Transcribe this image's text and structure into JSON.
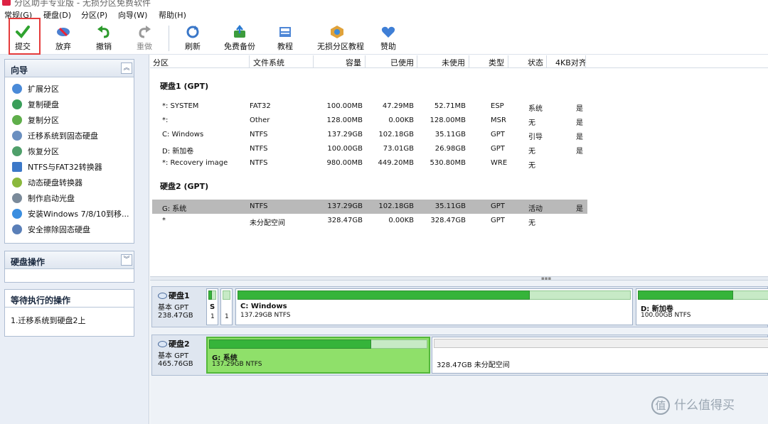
{
  "titlebar": {
    "text": "分区助手专业版 - 无损分区免费软件"
  },
  "menu": [
    {
      "label": "常规(G)"
    },
    {
      "label": "硬盘(D)"
    },
    {
      "label": "分区(P)"
    },
    {
      "label": "向导(W)"
    },
    {
      "label": "帮助(H)"
    }
  ],
  "toolbar": [
    {
      "label": "提交",
      "icon": "check-icon",
      "enabled": true
    },
    {
      "label": "放弃",
      "icon": "discard-icon",
      "enabled": true
    },
    {
      "label": "撤销",
      "icon": "undo-icon",
      "enabled": true
    },
    {
      "label": "重做",
      "icon": "redo-icon",
      "enabled": false
    },
    {
      "label": "刷新",
      "icon": "refresh-icon",
      "enabled": true
    },
    {
      "label": "免费备份",
      "icon": "backup-icon",
      "enabled": true
    },
    {
      "label": "教程",
      "icon": "tutorial-icon",
      "enabled": true
    },
    {
      "label": "无损分区教程",
      "icon": "partition-tutorial-icon",
      "enabled": true
    },
    {
      "label": "赞助",
      "icon": "heart-icon",
      "enabled": true
    }
  ],
  "wizard": {
    "title": "向导",
    "items": [
      {
        "label": "扩展分区"
      },
      {
        "label": "复制硬盘"
      },
      {
        "label": "复制分区"
      },
      {
        "label": "迁移系统到固态硬盘"
      },
      {
        "label": "恢复分区"
      },
      {
        "label": "NTFS与FAT32转换器"
      },
      {
        "label": "动态硬盘转换器"
      },
      {
        "label": "制作启动光盘"
      },
      {
        "label": "安装Windows 7/8/10到移..."
      },
      {
        "label": "安全擦除固态硬盘"
      }
    ]
  },
  "disk_ops": {
    "title": "硬盘操作"
  },
  "pending": {
    "title": "等待执行的操作",
    "items": [
      {
        "label": "1.迁移系统到硬盘2上"
      }
    ]
  },
  "columns": {
    "partition": "分区",
    "filesystem": "文件系统",
    "capacity": "容量",
    "used": "已使用",
    "free": "未使用",
    "type": "类型",
    "status": "状态",
    "align": "4KB对齐"
  },
  "disks": [
    {
      "title": "硬盘1 (GPT)",
      "rows": [
        {
          "name": "*: SYSTEM",
          "fs": "FAT32",
          "cap": "100.00MB",
          "used": "47.29MB",
          "free": "52.71MB",
          "type": "ESP",
          "status": "系统",
          "align": "是"
        },
        {
          "name": "*:",
          "fs": "Other",
          "cap": "128.00MB",
          "used": "0.00KB",
          "free": "128.00MB",
          "type": "MSR",
          "status": "无",
          "align": "是"
        },
        {
          "name": "C: Windows",
          "fs": "NTFS",
          "cap": "137.29GB",
          "used": "102.18GB",
          "free": "35.11GB",
          "type": "GPT",
          "status": "引导",
          "align": "是"
        },
        {
          "name": "D: 新加卷",
          "fs": "NTFS",
          "cap": "100.00GB",
          "used": "73.01GB",
          "free": "26.98GB",
          "type": "GPT",
          "status": "无",
          "align": "是"
        },
        {
          "name": "*: Recovery image",
          "fs": "NTFS",
          "cap": "980.00MB",
          "used": "449.20MB",
          "free": "530.80MB",
          "type": "WRE",
          "status": "无",
          "align": ""
        }
      ]
    },
    {
      "title": "硬盘2 (GPT)",
      "rows": [
        {
          "name": "G: 系统",
          "fs": "NTFS",
          "cap": "137.29GB",
          "used": "102.18GB",
          "free": "35.11GB",
          "type": "GPT",
          "status": "活动",
          "align": "是",
          "selected": true
        },
        {
          "name": "*",
          "fs": "未分配空间",
          "cap": "328.47GB",
          "used": "0.00KB",
          "free": "328.47GB",
          "type": "GPT",
          "status": "无",
          "align": ""
        }
      ]
    }
  ],
  "diskmap": [
    {
      "name": "硬盘1",
      "kind": "基本 GPT",
      "size": "238.47GB",
      "parts": [
        {
          "name": "S",
          "info": "1",
          "usage": 0.47
        },
        {
          "name": "",
          "info": "1",
          "usage": 0
        },
        {
          "name": "C: Windows",
          "info": "137.29GB NTFS",
          "usage": 0.744
        },
        {
          "name": "D: 新加卷",
          "info": "100.00GB NTFS",
          "usage": 0.73
        }
      ]
    },
    {
      "name": "硬盘2",
      "kind": "基本 GPT",
      "size": "465.76GB",
      "parts": [
        {
          "name": "G: 系统",
          "info": "137.29GB NTFS",
          "usage": 0.744
        },
        {
          "name": "",
          "info": "328.47GB 未分配空间",
          "usage": 0
        }
      ]
    }
  ],
  "watermark": {
    "icon": "值",
    "text": "什么值得买"
  }
}
